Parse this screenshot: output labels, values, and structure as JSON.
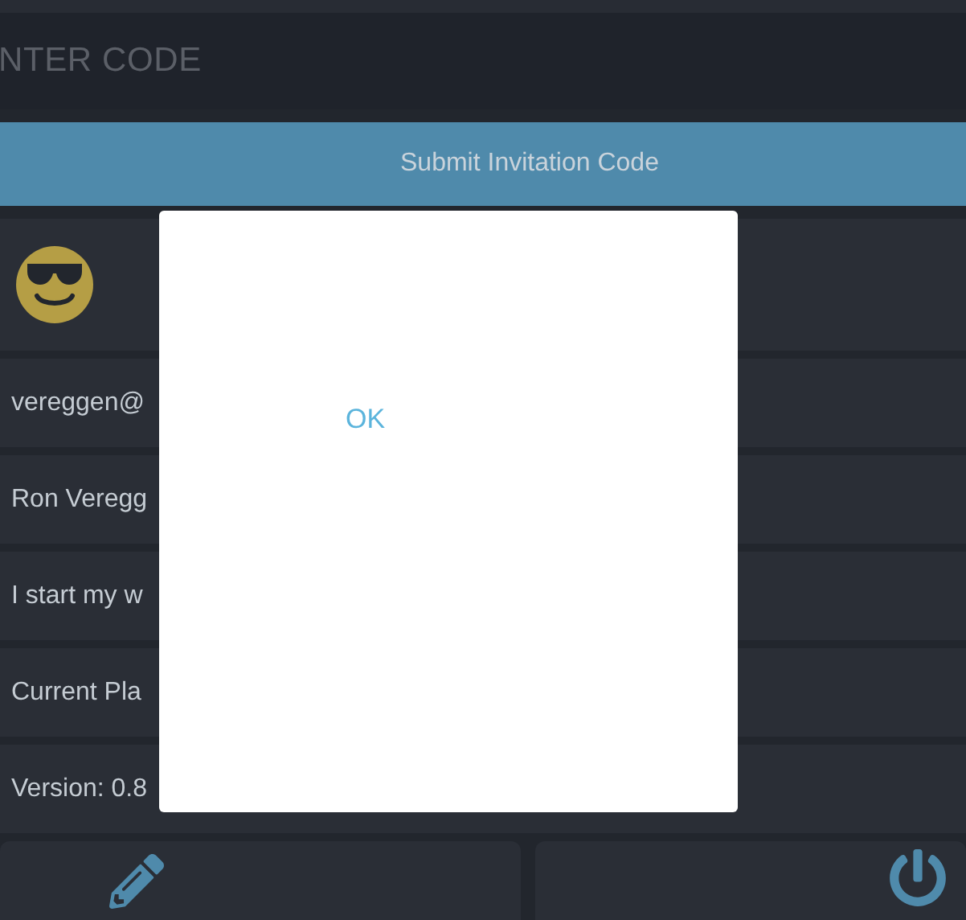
{
  "header": {
    "title": "NTER CODE"
  },
  "submit_button": {
    "label": "Submit Invitation Code"
  },
  "profile_rows": [
    "vereggen@",
    "Ron Veregg",
    "I start my w",
    "Current Pla",
    "Version: 0.8"
  ],
  "actions": [
    {
      "kind": "edit"
    },
    {
      "kind": "power"
    }
  ],
  "dialog": {
    "button": "OK"
  }
}
